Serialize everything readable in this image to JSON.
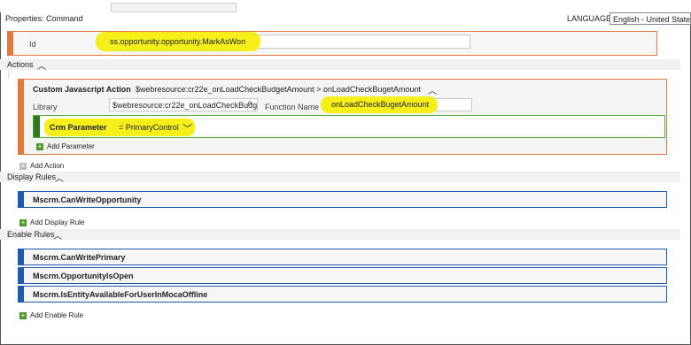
{
  "header": {
    "title": "Properties: Command",
    "language_label": "LANGUAGE:",
    "language_value": "English - United States"
  },
  "id_field": {
    "label": "Id",
    "value": "ss.opportunity.opportunity.MarkAsWon"
  },
  "actions_section": {
    "label": "Actions",
    "action": {
      "title": "Custom Javascript Action",
      "description": "$webresource:cr22e_onLoadCheckBudgetAmount > onLoadCheckBugetAmount",
      "library_label": "Library",
      "library_value": "$webresource:cr22e_onLoadCheckBudg",
      "function_label": "Function Name",
      "function_value": "onLoadCheckBugetAmount",
      "parameter": {
        "name": "Crm Parameter",
        "value": "= PrimaryControl"
      },
      "add_parameter": "Add Parameter"
    },
    "add_action": "Add Action"
  },
  "display_rules": {
    "label": "Display Rules",
    "items": [
      "Mscrm.CanWriteOpportunity"
    ],
    "add": "Add Display Rule"
  },
  "enable_rules": {
    "label": "Enable Rules",
    "items": [
      "Mscrm.CanWritePrimary",
      "Mscrm.OpportunityIsOpen",
      "Mscrm.IsEntityAvailableForUserInMocaOffline"
    ],
    "add": "Add Enable Rule"
  },
  "icons": {
    "search": "search-icon",
    "chevron_up": "chevron-up-icon",
    "chevron_down": "chevron-down-icon",
    "plus": "plus-icon"
  },
  "colors": {
    "action_accent": "#e07a3c",
    "param_accent": "#2d7a1e",
    "rule_accent": "#1e5bb0",
    "highlight": "#f7ef1a"
  }
}
